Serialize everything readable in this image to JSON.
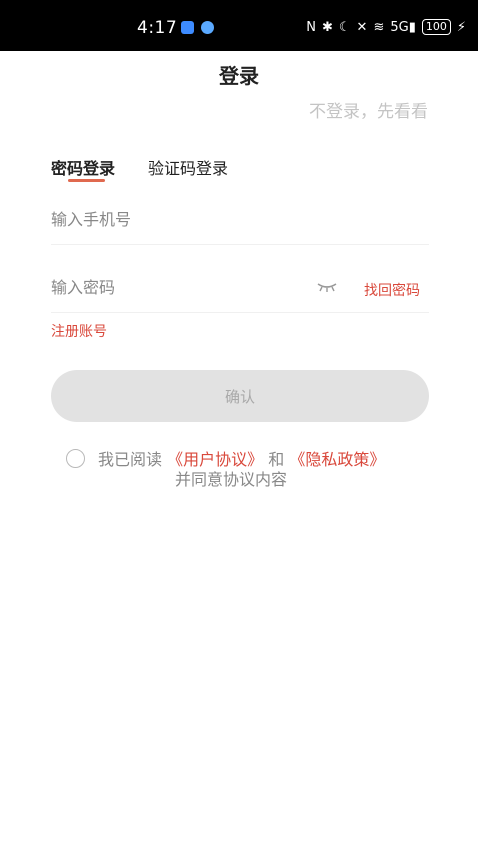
{
  "status_bar": {
    "time": "4:17",
    "signal_text": "5G",
    "battery": "100"
  },
  "header": {
    "title": "登录",
    "skip_label": "不登录，先看看"
  },
  "tabs": [
    {
      "label": "密码登录",
      "active": true
    },
    {
      "label": "验证码登录",
      "active": false
    }
  ],
  "form": {
    "phone_placeholder": "输入手机号",
    "password_placeholder": "输入密码",
    "forgot_label": "找回密码",
    "register_label": "注册账号",
    "confirm_label": "确认"
  },
  "agreement": {
    "prefix": "我已阅读",
    "user_agreement": "《用户协议》",
    "conjunction": "和",
    "privacy_policy": "《隐私政策》",
    "suffix": "并同意协议内容",
    "checked": false
  },
  "colors": {
    "accent": "#d9483b",
    "tab_indicator": "#e0694f",
    "button_disabled": "#e2e2e2"
  }
}
